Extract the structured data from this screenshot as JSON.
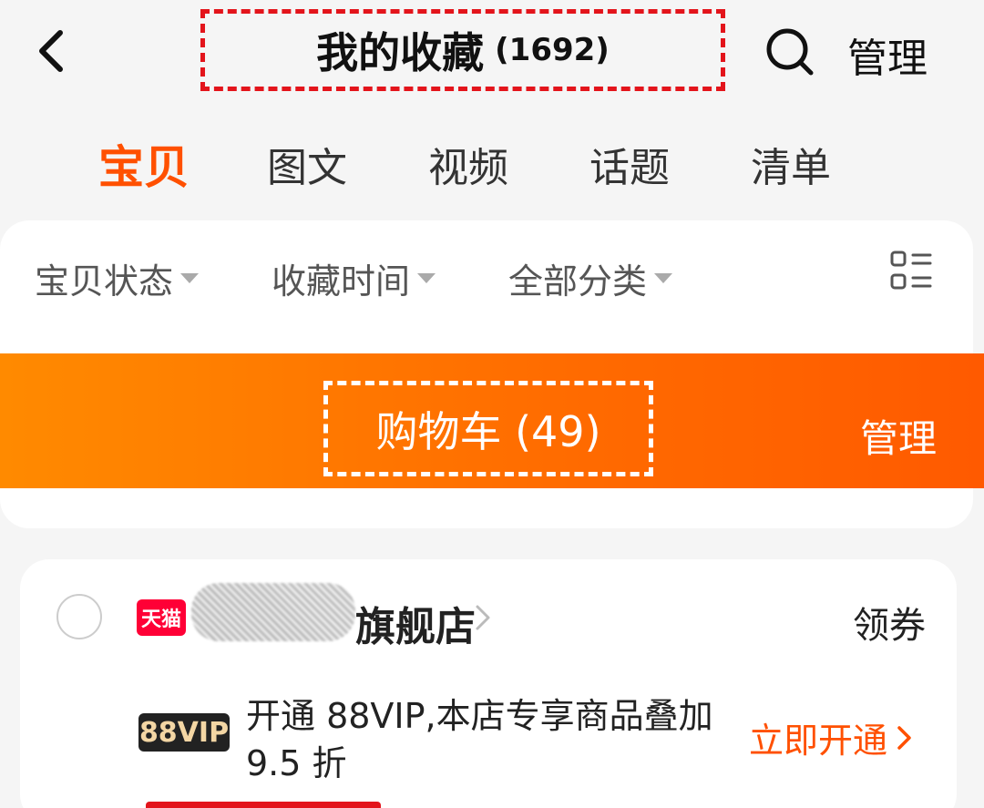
{
  "header": {
    "title": "我的收藏",
    "count": "(1692)",
    "manage_label": "管理",
    "icons": {
      "back": "back-chevron-icon",
      "search": "search-icon"
    }
  },
  "tabs": [
    {
      "label": "宝贝",
      "active": true
    },
    {
      "label": "图文",
      "active": false
    },
    {
      "label": "视频",
      "active": false
    },
    {
      "label": "话题",
      "active": false
    },
    {
      "label": "清单",
      "active": false
    }
  ],
  "filters": [
    {
      "label": "宝贝状态"
    },
    {
      "label": "收藏时间"
    },
    {
      "label": "全部分类"
    }
  ],
  "cart": {
    "title": "购物车 (49)",
    "manage_label": "管理"
  },
  "store": {
    "badge": "天猫",
    "name_visible": "旗舰店",
    "coupon_label": "领券"
  },
  "vip": {
    "badge": "88VIP",
    "text": "开通 88VIP,本店专享商品叠加 9.5 折",
    "action_label": "立即开通"
  },
  "colors": {
    "accent": "#ff5000",
    "banner": "#ff7a00",
    "dashed_red": "#e3141b",
    "tmall": "#ff0036"
  }
}
